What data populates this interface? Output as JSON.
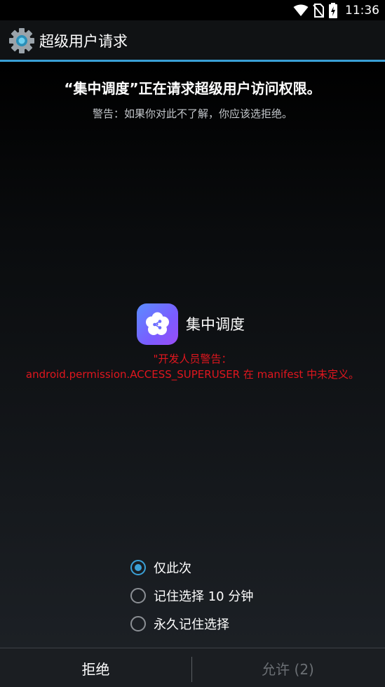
{
  "status_bar": {
    "time": "11:36",
    "icons": [
      "wifi-icon",
      "no-sim-icon",
      "battery-charging-icon"
    ]
  },
  "app_bar": {
    "icon": "gear-icon",
    "title": "超级用户请求"
  },
  "request": {
    "headline": "“集中调度”正在请求超级用户访问权限。",
    "warning": "警告：如果你对此不了解，你应该选拒绝。"
  },
  "app": {
    "name": "集中调度",
    "icon": "app-flower-icon"
  },
  "dev_warning": {
    "line1": "\"开发人员警告：",
    "line2": "android.permission.ACCESS_SUPERUSER 在 manifest 中未定义。"
  },
  "options": [
    {
      "label": "仅此次",
      "checked": true
    },
    {
      "label": "记住选择 10 分钟",
      "checked": false
    },
    {
      "label": "永久记住选择",
      "checked": false
    }
  ],
  "buttons": {
    "deny": "拒绝",
    "allow": "允许 (2)"
  },
  "colors": {
    "accent": "#3aa0d6",
    "dev_warning": "#e0161e"
  }
}
